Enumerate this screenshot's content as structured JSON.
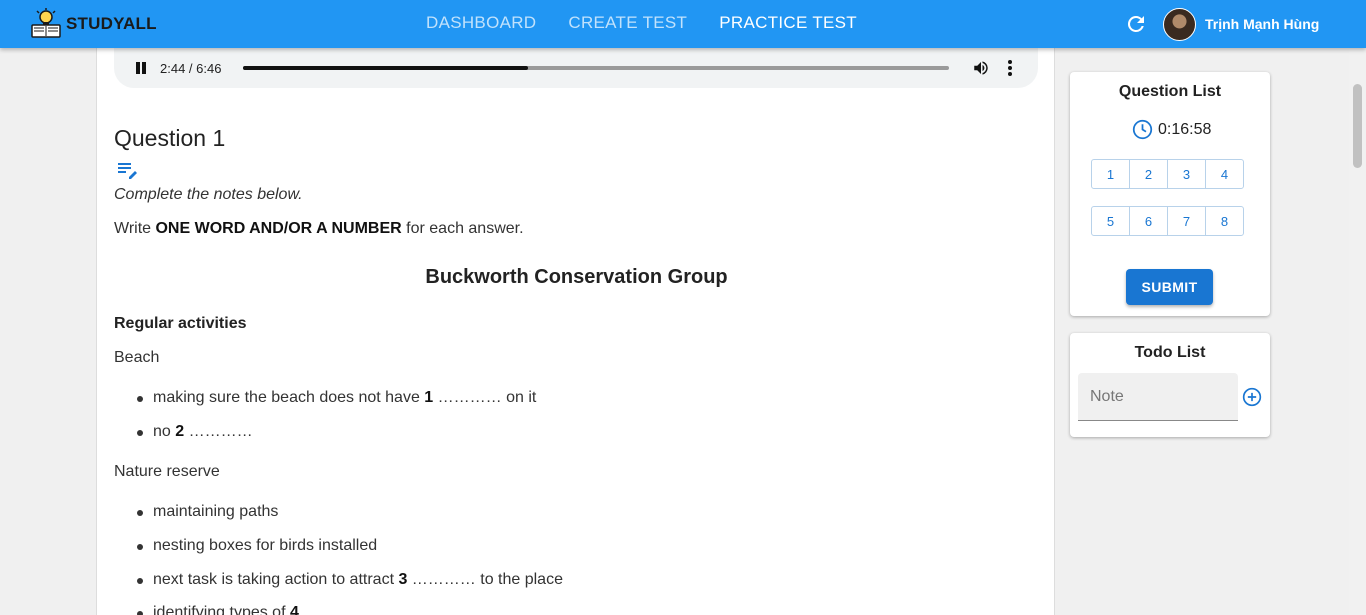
{
  "header": {
    "brand": "STUDYALL",
    "nav": [
      "DASHBOARD",
      "CREATE TEST",
      "PRACTICE TEST"
    ],
    "active_nav": "PRACTICE TEST",
    "username": "Trịnh Mạnh Hùng",
    "colors": {
      "appbar": "#2196f3",
      "accent": "#1976d2"
    }
  },
  "audio": {
    "time": "2:44 / 6:46",
    "progress": 0.4039
  },
  "question": {
    "title": "Question 1",
    "instruction1": "Complete the notes below.",
    "instruction2_pre": "Write ",
    "instruction2_bold": "ONE WORD AND/OR A NUMBER",
    "instruction2_post": " for each answer.",
    "doc_title": "Buckworth Conservation Group",
    "section": "Regular activities",
    "beach_label": "Beach",
    "beach_item1_pre": "making sure the beach does not have ",
    "beach_item1_num": "1",
    "beach_item1_post": " ………… on it",
    "beach_item2_pre": "no ",
    "beach_item2_num": "2",
    "beach_item2_post": " …………",
    "nature_label": "Nature reserve",
    "nature_item1": "maintaining paths",
    "nature_item2": "nesting boxes for birds installed",
    "nature_item3_pre": "next task is taking action to attract ",
    "nature_item3_num": "3",
    "nature_item3_post": " ………… to the place",
    "nature_item4_pre": "identifying types of ",
    "nature_item4_num": "4"
  },
  "question_list": {
    "title": "Question List",
    "timer": "0:16:58",
    "row1": [
      "1",
      "2",
      "3",
      "4"
    ],
    "row2": [
      "5",
      "6",
      "7",
      "8"
    ],
    "submit_label": "SUBMIT"
  },
  "todo": {
    "title": "Todo List",
    "placeholder": "Note",
    "value": ""
  }
}
